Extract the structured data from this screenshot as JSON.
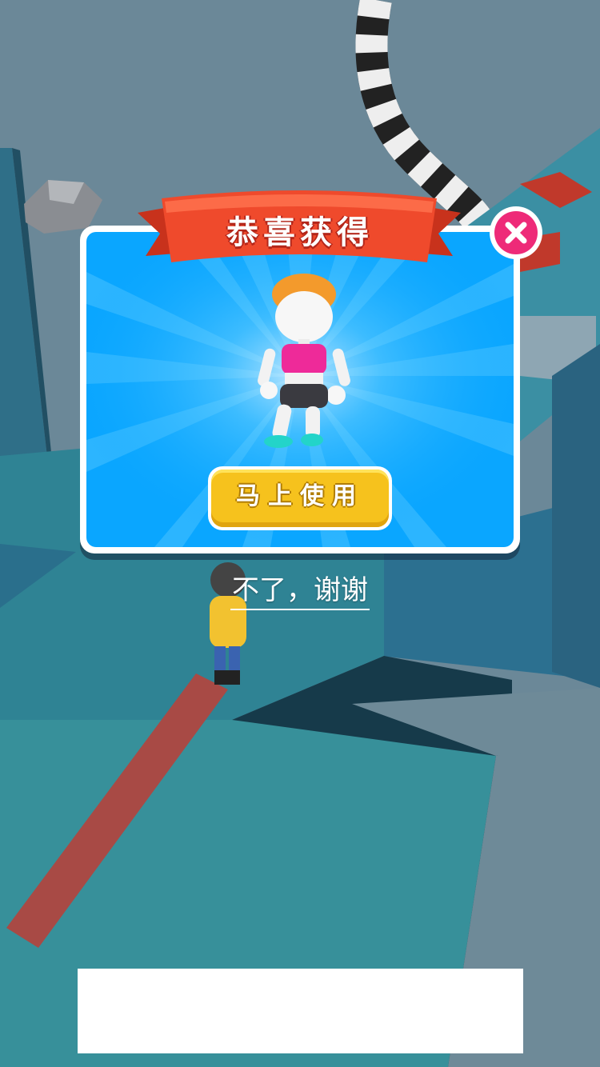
{
  "reward_dialog": {
    "title": "恭喜获得",
    "use_button_label": "马上使用",
    "close_icon": "close-icon",
    "reward_item": "character-skin"
  },
  "decline_link": "不了，谢谢",
  "colors": {
    "dialog_blue": "#0aa6ff",
    "ribbon_red": "#ef4a2c",
    "button_yellow": "#f6c21d",
    "close_pink": "#ee2a78"
  }
}
